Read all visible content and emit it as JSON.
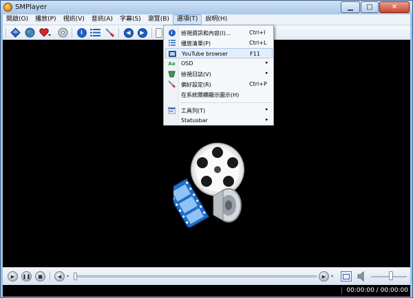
{
  "window": {
    "title": "SMPlayer",
    "minimize_glyph": "▁",
    "maximize_glyph": "□",
    "close_glyph": "✕"
  },
  "menubar": {
    "items": [
      {
        "label": "開啟(O)"
      },
      {
        "label": "播放(P)"
      },
      {
        "label": "視訊(V)"
      },
      {
        "label": "音訊(A)"
      },
      {
        "label": "字幕(S)"
      },
      {
        "label": "瀏覽(B)"
      },
      {
        "label": "選項(T)",
        "active": true
      },
      {
        "label": "說明(H)"
      }
    ]
  },
  "toolbar": {
    "icons": [
      "open-icon",
      "globe-icon",
      "favorites-heart-icon",
      "disc-icon",
      "info-icon",
      "playlist-icon",
      "preferences-icon",
      "previous-icon",
      "next-icon"
    ]
  },
  "options_menu": {
    "items": [
      {
        "label": "檢視資訊和內容(I)...",
        "shortcut": "Ctrl+I",
        "icon": "info-icon"
      },
      {
        "label": "播放清單(P)",
        "shortcut": "Ctrl+L",
        "icon": "playlist-icon"
      },
      {
        "label": "YouTube browser",
        "shortcut": "F11",
        "icon": "youtube-icon",
        "highlighted": true
      },
      {
        "label": "OSD",
        "submenu": true,
        "icon": "osd-icon"
      },
      {
        "label": "檢視日誌(V)",
        "submenu": true,
        "icon": "log-icon"
      },
      {
        "label": "偏好設定(R)",
        "shortcut": "Ctrl+P",
        "icon": "preferences-icon"
      },
      {
        "label": "在系統閘欄顯示圖示(H)"
      },
      {
        "label": "工具列(T)",
        "submenu": true,
        "icon": "toolbar-icon"
      },
      {
        "label": "Statusbar",
        "submenu": true
      }
    ],
    "submenu_arrow": "▸"
  },
  "controls": {
    "icons": [
      "play-icon",
      "pause-icon",
      "stop-icon",
      "rewind-icon",
      "forward-icon",
      "fullscreen-icon",
      "volume-icon"
    ],
    "seek_position": 0,
    "volume_level": 0.55
  },
  "statusbar": {
    "time": "00:00:00 / 00:00:00"
  },
  "colors": {
    "accent": "#2f6fcf",
    "video_background": "#000000"
  }
}
